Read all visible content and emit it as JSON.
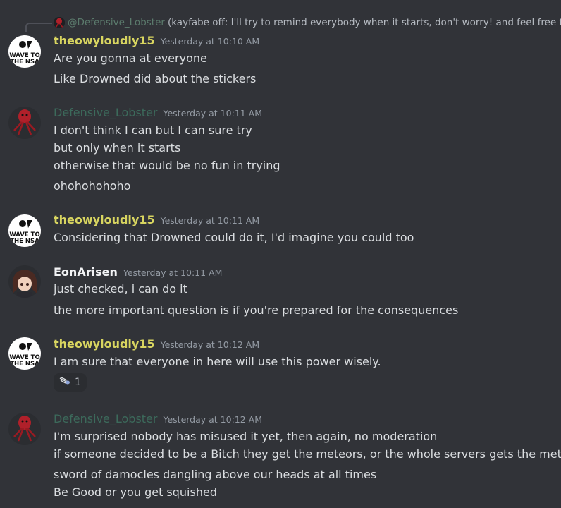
{
  "reply": {
    "author": "@Defensive_Lobster",
    "text": "(kayfabe off: I'll try to remind everybody when it starts, don't worry! and feel free to"
  },
  "messages": [
    {
      "author": "theowyloudly15",
      "timestamp": "Yesterday at 10:10 AM",
      "avatar_text": [
        "WAVE TO",
        "THE NSA"
      ],
      "lines": [
        "Are you gonna at everyone",
        "Like Drowned did about the stickers"
      ]
    },
    {
      "author": "Defensive_Lobster",
      "timestamp": "Yesterday at 10:11 AM",
      "lines": [
        "I don't think I can but I can sure try",
        "but only when it starts",
        "otherwise that would be no fun in trying",
        "ohohohohoho"
      ]
    },
    {
      "author": "theowyloudly15",
      "timestamp": "Yesterday at 10:11 AM",
      "avatar_text": [
        "WAVE TO",
        "THE NSA"
      ],
      "lines": [
        "Considering that Drowned could do it, I'd imagine you could too"
      ]
    },
    {
      "author": "EonArisen",
      "timestamp": "Yesterday at 10:11 AM",
      "lines": [
        "just checked, i can do it",
        "the more important question is if you're prepared for the consequences"
      ]
    },
    {
      "author": "theowyloudly15",
      "timestamp": "Yesterday at 10:12 AM",
      "avatar_text": [
        "WAVE TO",
        "THE NSA"
      ],
      "lines": [
        "I am sure that everyone in here will use this power wisely."
      ],
      "reaction": {
        "icon": "meteor-emoji-icon",
        "count": "1"
      }
    },
    {
      "author": "Defensive_Lobster",
      "timestamp": "Yesterday at 10:12 AM",
      "lines": [
        "I'm surprised nobody has misused it yet, then again, no moderation",
        "if someone decided to be a Bitch they get the meteors, or the whole servers gets the meteors",
        "sword of damocles dangling above our heads at all times",
        "Be Good or you get squished"
      ]
    }
  ],
  "colors": {
    "background": "#313338",
    "author_theowyloudly15": "#d8d560",
    "author_defensive_lobster": "#3c6a5b",
    "author_eonarisen": "#f2f3f5",
    "timestamp": "#949ba4"
  }
}
